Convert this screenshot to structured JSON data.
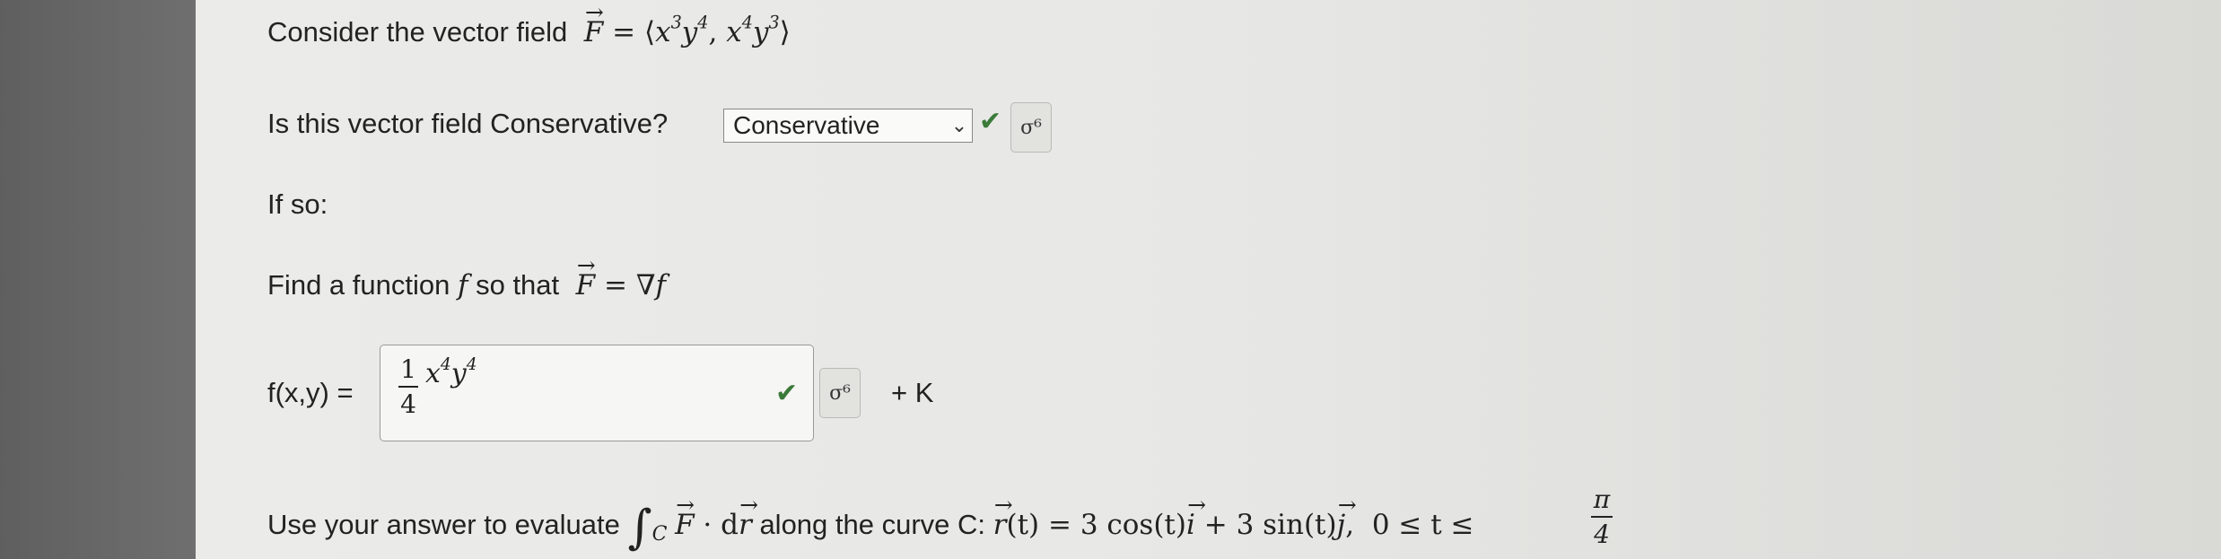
{
  "question": {
    "intro": "Consider the vector field",
    "field_expr": {
      "F": "F",
      "eq": " = ",
      "open": "⟨",
      "x": "x",
      "p3": "3",
      "y": "y",
      "p4": "4",
      "comma": ", ",
      "close": "⟩"
    },
    "conservative_prompt": "Is this vector field Conservative?",
    "if_so": "If so:",
    "find_function": "Find a function",
    "f_symbol": "f",
    "so_that": "so that",
    "gradient_expr": " = ∇",
    "fxy_label": "f(x,y) =",
    "plus_k": "+ K",
    "evaluate_text": "Use your answer to evaluate",
    "along_curve": "along the curve C:"
  },
  "dropdown": {
    "selected": "Conservative",
    "status": "correct"
  },
  "answer": {
    "numerator": "1",
    "denominator": "4",
    "rest": "x",
    "pow": "4",
    "y": "y",
    "pow2": "4",
    "status": "correct"
  },
  "integral": {
    "sign": "∫",
    "sub": "C",
    "F": "F",
    "dot": " · d",
    "r": "r",
    "curve": {
      "r": "r",
      "t": "(t) = 3 cos(t)",
      "i": "i",
      "plus": " + 3 sin(t)",
      "j": "j",
      "comma": ",",
      "range": "0 ≤ t ≤",
      "pi": "π",
      "four": "4"
    }
  },
  "icons": {
    "check": "✔",
    "chevron": "⌄",
    "sigma": "σ⁶"
  }
}
